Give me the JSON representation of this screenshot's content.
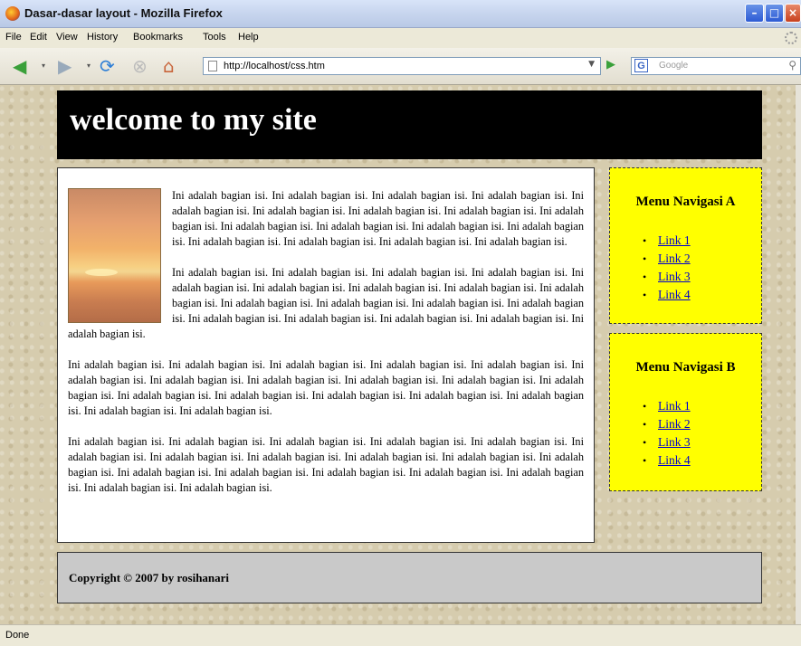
{
  "window": {
    "title": "Dasar-dasar layout - Mozilla Firefox",
    "minimize": "–",
    "maximize": "□",
    "close": "×"
  },
  "menu": [
    "File",
    "Edit",
    "View",
    "History",
    "Bookmarks",
    "Tools",
    "Help"
  ],
  "nav": {
    "url": "http://localhost/css.htm",
    "search_placeholder": "Google"
  },
  "page": {
    "site_title": "welcome to my site",
    "paragraphs": [
      "Ini adalah bagian isi. Ini adalah bagian isi. Ini adalah bagian isi. Ini adalah bagian isi. Ini adalah bagian isi. Ini adalah bagian isi. Ini adalah bagian isi. Ini adalah bagian isi. Ini adalah bagian isi. Ini adalah bagian isi. Ini adalah bagian isi. Ini adalah bagian isi. Ini adalah bagian isi. Ini adalah bagian isi. Ini adalah bagian isi. Ini adalah bagian isi. Ini adalah bagian isi.",
      "Ini adalah bagian isi. Ini adalah bagian isi. Ini adalah bagian isi. Ini adalah bagian isi. Ini adalah bagian isi. Ini adalah bagian isi. Ini adalah bagian isi. Ini adalah bagian isi. Ini adalah bagian isi. Ini adalah bagian isi. Ini adalah bagian isi. Ini adalah bagian isi. Ini adalah bagian isi. Ini adalah bagian isi. Ini adalah bagian isi. Ini adalah bagian isi. Ini adalah bagian isi. Ini adalah bagian isi.",
      "Ini adalah bagian isi. Ini adalah bagian isi. Ini adalah bagian isi. Ini adalah bagian isi. Ini adalah bagian isi. Ini adalah bagian isi. Ini adalah bagian isi. Ini adalah bagian isi. Ini adalah bagian isi. Ini adalah bagian isi. Ini adalah bagian isi. Ini adalah bagian isi. Ini adalah bagian isi. Ini adalah bagian isi. Ini adalah bagian isi. Ini adalah bagian isi. Ini adalah bagian isi. Ini adalah bagian isi.",
      "Ini adalah bagian isi. Ini adalah bagian isi. Ini adalah bagian isi. Ini adalah bagian isi. Ini adalah bagian isi. Ini adalah bagian isi. Ini adalah bagian isi. Ini adalah bagian isi. Ini adalah bagian isi. Ini adalah bagian isi. Ini adalah bagian isi. Ini adalah bagian isi. Ini adalah bagian isi. Ini adalah bagian isi. Ini adalah bagian isi. Ini adalah bagian isi. Ini adalah bagian isi. Ini adalah bagian isi."
    ],
    "menu_a": {
      "title": "Menu Navigasi A",
      "links": [
        "Link 1",
        "Link 2",
        "Link 3",
        "Link 4"
      ]
    },
    "menu_b": {
      "title": "Menu Navigasi B",
      "links": [
        "Link 1",
        "Link 2",
        "Link 3",
        "Link 4"
      ]
    },
    "footer": "Copyright © 2007 by rosihanari"
  },
  "status": "Done"
}
